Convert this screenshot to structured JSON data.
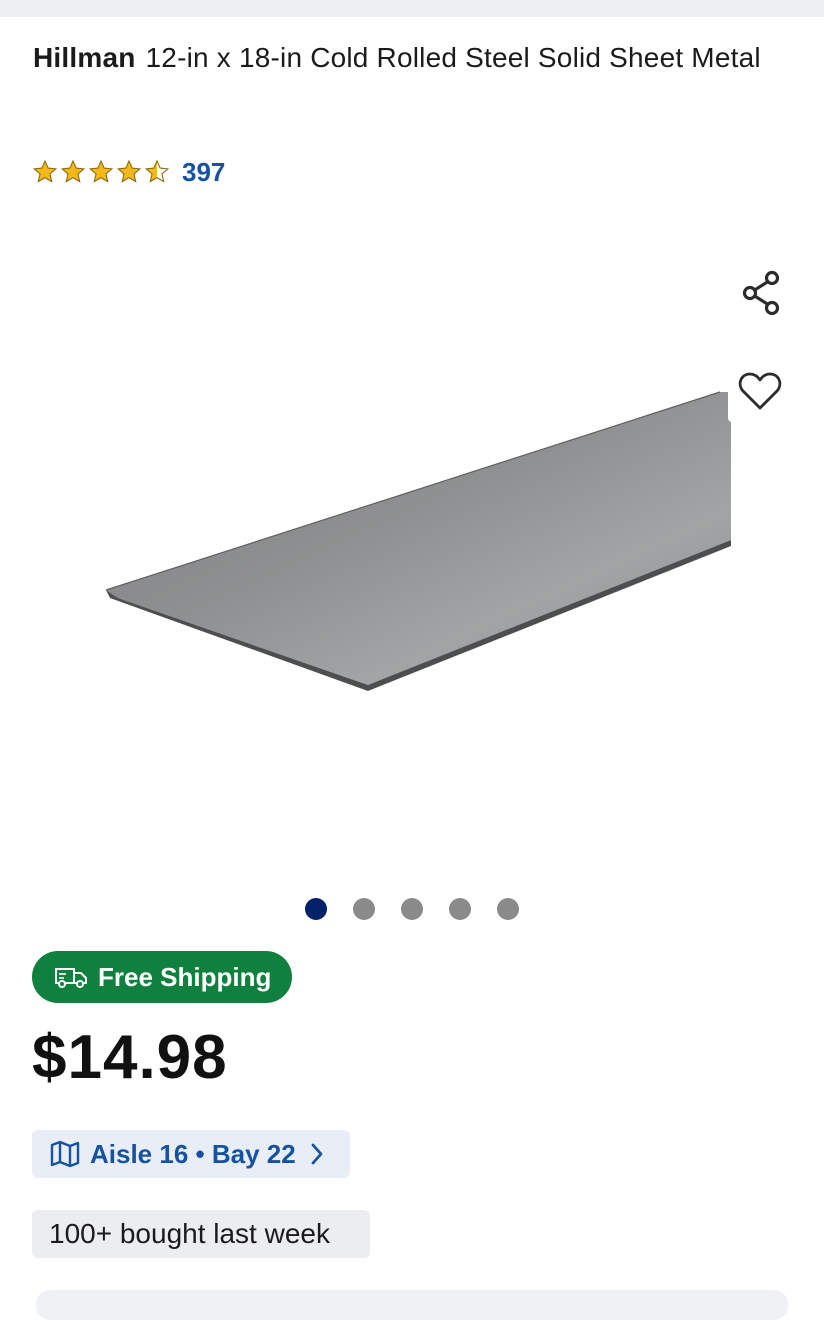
{
  "product": {
    "brand": "Hillman",
    "title": "12-in x 18-in Cold Rolled Steel Solid Sheet Metal",
    "rating_value": 4.5,
    "rating_count": "397",
    "price": "$14.98"
  },
  "gallery": {
    "image_count": 5,
    "active_index": 0
  },
  "badges": {
    "shipping": "Free Shipping",
    "aisle": "Aisle 16 • Bay 22",
    "bought": "100+ bought last week"
  },
  "icons": {
    "share": "share-icon",
    "favorite": "heart-icon",
    "truck": "truck-icon",
    "map": "map-icon",
    "chevron": "chevron-right-icon",
    "star": "star-icon"
  },
  "colors": {
    "accent_blue": "#1553a2",
    "dot_active": "#012169",
    "dot_inactive": "#8a8a8a",
    "shipping_green": "#10803e",
    "star_gold": "#f5b81b"
  }
}
